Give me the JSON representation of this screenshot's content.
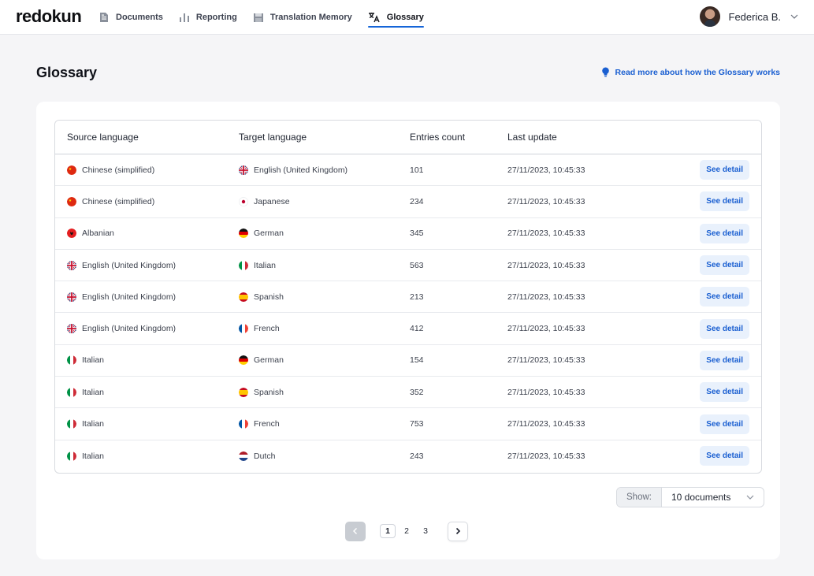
{
  "brand": "redokun",
  "nav": [
    {
      "label": "Documents",
      "icon": "document-icon",
      "active": false
    },
    {
      "label": "Reporting",
      "icon": "bar-chart-icon",
      "active": false
    },
    {
      "label": "Translation Memory",
      "icon": "database-icon",
      "active": false
    },
    {
      "label": "Glossary",
      "icon": "translate-icon",
      "active": true
    }
  ],
  "user": {
    "name": "Federica B."
  },
  "page": {
    "title": "Glossary",
    "help_link": "Read more about how the Glossary works"
  },
  "table": {
    "headers": [
      "Source language",
      "Target language",
      "Entries count",
      "Last update"
    ],
    "rows": [
      {
        "source": "Chinese (simplified)",
        "source_flag": "cn",
        "target": "English (United Kingdom)",
        "target_flag": "gb",
        "count": "101",
        "updated": "27/11/2023, 10:45:33",
        "action": "See detail"
      },
      {
        "source": "Chinese (simplified)",
        "source_flag": "cn",
        "target": "Japanese",
        "target_flag": "jp",
        "count": "234",
        "updated": "27/11/2023, 10:45:33",
        "action": "See detail"
      },
      {
        "source": "Albanian",
        "source_flag": "al",
        "target": "German",
        "target_flag": "de",
        "count": "345",
        "updated": "27/11/2023, 10:45:33",
        "action": "See detail"
      },
      {
        "source": "English (United Kingdom)",
        "source_flag": "gb",
        "target": "Italian",
        "target_flag": "it",
        "count": "563",
        "updated": "27/11/2023, 10:45:33",
        "action": "See detail"
      },
      {
        "source": "English (United Kingdom)",
        "source_flag": "gb",
        "target": "Spanish",
        "target_flag": "es",
        "count": "213",
        "updated": "27/11/2023, 10:45:33",
        "action": "See detail"
      },
      {
        "source": "English (United Kingdom)",
        "source_flag": "gb",
        "target": "French",
        "target_flag": "fr",
        "count": "412",
        "updated": "27/11/2023, 10:45:33",
        "action": "See detail"
      },
      {
        "source": "Italian",
        "source_flag": "it",
        "target": "German",
        "target_flag": "de",
        "count": "154",
        "updated": "27/11/2023, 10:45:33",
        "action": "See detail"
      },
      {
        "source": "Italian",
        "source_flag": "it",
        "target": "Spanish",
        "target_flag": "es",
        "count": "352",
        "updated": "27/11/2023, 10:45:33",
        "action": "See detail"
      },
      {
        "source": "Italian",
        "source_flag": "it",
        "target": "French",
        "target_flag": "fr",
        "count": "753",
        "updated": "27/11/2023, 10:45:33",
        "action": "See detail"
      },
      {
        "source": "Italian",
        "source_flag": "it",
        "target": "Dutch",
        "target_flag": "nl",
        "count": "243",
        "updated": "27/11/2023, 10:45:33",
        "action": "See detail"
      }
    ]
  },
  "show": {
    "label": "Show:",
    "value": "10 documents"
  },
  "pagination": {
    "pages": [
      "1",
      "2",
      "3"
    ],
    "current": "1"
  },
  "colors": {
    "accent": "#1565d8",
    "link": "#1a5fd1",
    "button_bg": "#e9f1fc"
  }
}
